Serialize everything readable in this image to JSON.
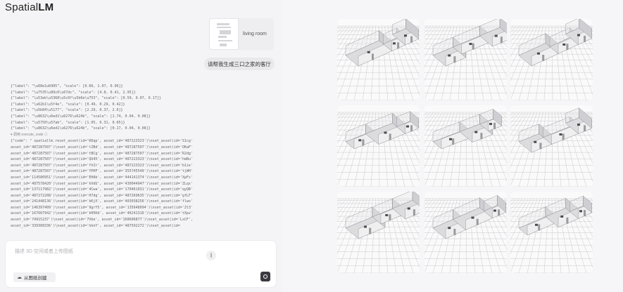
{
  "app": {
    "logo_prefix": "Spatial",
    "logo_suffix": "LM"
  },
  "attachment": {
    "label": "living room"
  },
  "user_message": "请帮我生成三口之家的客厅",
  "code_output": {
    "lines": [
      "{\"label\": \"\\u68e1u6905\", \"scale\": [0.66, 1.07, 0.96]}",
      "{\"label\": \"\\u7535\\u89c6\\u67dc\", \"scale\": [4.8, 0.41, 2.95]}",
      "{\"label\": \"\\u53eb\\u5368\\u5c0f\\u5b6e\\u753\", \"scale\": [0.59, 0.07, 0.17]}",
      "{\"label\": \"\\u62b1\\u5f4e\", \"scale\": [0.49, 0.29, 0.42]}",
      "{\"label\": \"\\u5b84\\u5177\", \"scale\": [2.29, 0.37, 2.6]}",
      "{\"label\": \"\\u8632\\u6ed1\\u6276\\u624b\", \"scale\": [1.74, 0.04, 0.08]}",
      "{\"label\": \"\\u5750\\u57ab\", \"scale\": [1.05, 0.31, 0.05]}",
      "{\"label\": \"\\u8632\\u6ed1\\u6276\\u624b\", \"scale\": [0.17, 0.04, 0.08]}"
    ],
    "exec_label": "▾ 调用 execute_code ⓘ",
    "code_lines": [
      "{\"code\": \"   spatiallm.reset_asset(id='KDqp', asset_id='487223323')\\nset_asset(id='S1cg',",
      "asset_id='487287507')\\nset_asset(id='tZBd', asset_id='487287507')\\nset_asset(id='OKaF',",
      "asset_id='487287507')\\nset_asset(id='tBCg', asset_id='487287507')\\nset_asset(id='R2dg',",
      "asset_id='487287507')\\nset_asset(id='QU45', asset_id='487223323')\\nset_asset(id='hmBu',",
      "asset_id='487287507')\\nset_asset(id='fhZr', asset_id='487223323')\\nset_asset(id='b1ie',",
      "asset_id='487287507')\\nset_asset(id='YPHF', asset_id='355745540')\\nset_asset(id='tjWH',",
      "asset_id='114580951')\\nset_asset(id='EHAb', asset_id='444141374')\\nset_asset(id='XpFs',",
      "asset_id='487578420')\\nset_asset(id='kVdU', asset_id='430944947')\\nset_asset(id='ZLqx',",
      "asset_id='137117982')\\nset_asset(id='4Cwa', asset_id='170461031')\\nset_asset(id='qyQB',",
      "asset_id='487272208')\\nset_asset(id='H7dg', asset_id='487269635')\\nset_asset(id='gfLF',",
      "asset_id='241448136')\\nset_asset(id='kKjX', asset_id='403038256')\\nset_asset(id='flwo',",
      "asset_id='146397409')\\nset_asset(id='9grY5', asset_id='135648094')\\nset_asset(id='Zt3',",
      "asset_id='167607942')\\nset_asset(id='kH5Kd', asset_id='46241316')\\nset_asset(id='tXpz',",
      "asset_id='74915237')\\nset_asset(id='7Vbe', asset_id='168606877')\\nset_asset(id='LxCF',",
      "asset_id='339308336')\\nset_asset(id='hknY', asset_id='487592272')\\nset_asset(id="
    ]
  },
  "composer": {
    "placeholder": "描述 3D 空间或者上传图纸",
    "create_label": "从图纸创建"
  },
  "colors": {
    "grid": "#c9c9cd",
    "wall": "#efefef",
    "wall_dark": "#9a9a9e",
    "bg": "#f6f6f8"
  },
  "renders": [
    {
      "layout": "a"
    },
    {
      "layout": "b"
    },
    {
      "layout": "c"
    },
    {
      "layout": "d"
    },
    {
      "layout": "e"
    },
    {
      "layout": "f"
    },
    {
      "layout": "g"
    },
    {
      "layout": "h"
    },
    {
      "layout": "i"
    }
  ]
}
